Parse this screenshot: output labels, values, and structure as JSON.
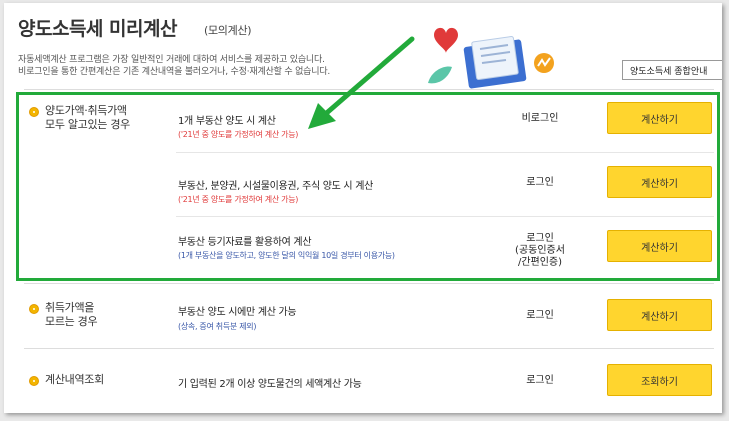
{
  "header": {
    "title": "양도소득세 미리계산",
    "title_sub": "(모의계산)",
    "desc_line1": "자동세액계산 프로그램은 가장 일반적인 거래에 대하여 서비스를 제공하고 있습니다.",
    "desc_line2": "비로그인을 통한 간편계산은 기존 계산내역을 불러오거나, 수정·재계산할 수 없습니다.",
    "guide_button": "양도소득세 종합안내"
  },
  "rows": [
    {
      "category": [
        "양도가액·취득가액",
        "모두 알고있는 경우"
      ],
      "items": [
        {
          "main": "1개 부동산 양도 시 계산",
          "sub": "('21년 중 양도를 가정하여 계산 가능)",
          "status": [
            "비로그인"
          ],
          "button": "계산하기"
        },
        {
          "main": "부동산, 분양권, 시설물이용권, 주식 양도 시 계산",
          "sub": "('21년 중 양도를 가정하여 계산 가능)",
          "status": [
            "로그인"
          ],
          "button": "계산하기"
        },
        {
          "main": "부동산 등기자료를 활용하여 계산",
          "sub": "(1개 부동산을 양도하고, 양도한 달의 익익월 10일 경부터 이용가능)",
          "status": [
            "로그인",
            "(공동인증서",
            "/간편인증)"
          ],
          "button": "계산하기"
        }
      ]
    },
    {
      "category": [
        "취득가액을",
        "모르는 경우"
      ],
      "items": [
        {
          "main": "부동산 양도 시에만 계산 가능",
          "sub": "(상속, 증여 취득분 제외)",
          "status": [
            "로그인"
          ],
          "button": "계산하기"
        }
      ]
    },
    {
      "category": [
        "계산내역조회"
      ],
      "items": [
        {
          "main": "기 입력된 2개 이상 양도물건의 세액계산 가능",
          "sub": "",
          "status": [
            "로그인"
          ],
          "button": "조회하기"
        }
      ]
    }
  ],
  "colors": {
    "accent_button": "#ffd52e",
    "highlight_box": "#22aa3a",
    "bullet": "#f3b500",
    "sub_red": "#e03a3a",
    "sub_blue": "#3a58a8"
  },
  "icons": [
    "heart-icon",
    "document-icon",
    "leaf-icon",
    "chart-badge-icon",
    "arrow-annotation-icon"
  ]
}
